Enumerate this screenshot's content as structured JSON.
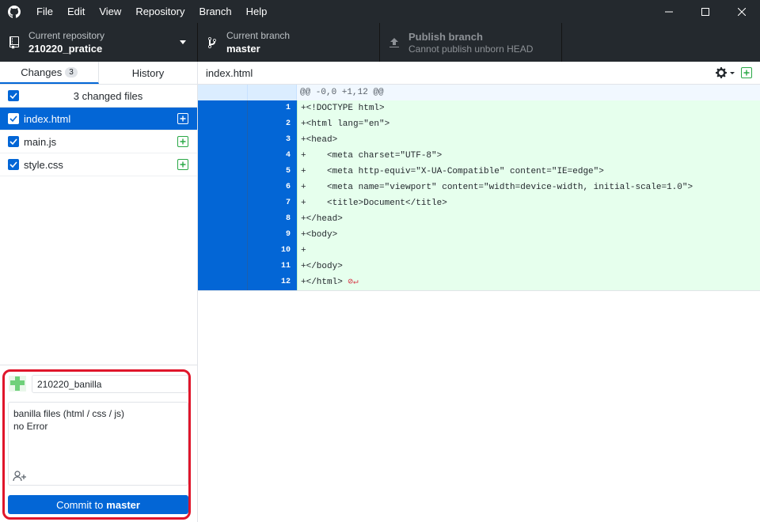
{
  "menubar": {
    "items": [
      "File",
      "Edit",
      "View",
      "Repository",
      "Branch",
      "Help"
    ]
  },
  "toolbar": {
    "repo": {
      "label": "Current repository",
      "value": "210220_pratice"
    },
    "branch": {
      "label": "Current branch",
      "value": "master"
    },
    "publish": {
      "label": "Publish branch",
      "value": "Cannot publish unborn HEAD"
    }
  },
  "sidebar": {
    "tabs": [
      {
        "label": "Changes",
        "count": "3"
      },
      {
        "label": "History"
      }
    ],
    "changes_header": "3 changed files",
    "files": [
      {
        "name": "index.html",
        "selected": true
      },
      {
        "name": "main.js",
        "selected": false
      },
      {
        "name": "style.css",
        "selected": false
      }
    ]
  },
  "commit": {
    "summary": "210220_banilla",
    "description_lines": [
      "banilla files (html / css / js)",
      "no Error"
    ],
    "button_prefix": "Commit to",
    "button_branch": "master"
  },
  "diff": {
    "filename": "index.html",
    "hunk_header": "@@ -0,0 +1,12 @@",
    "line_numbers": [
      "1",
      "2",
      "3",
      "4",
      "5",
      "6",
      "7",
      "8",
      "9",
      "10",
      "11",
      "12"
    ],
    "lines": [
      "+<!DOCTYPE html>",
      "+<html lang=\"en\">",
      "+<head>",
      "+    <meta charset=\"UTF-8\">",
      "+    <meta http-equiv=\"X-UA-Compatible\" content=\"IE=edge\">",
      "+    <meta name=\"viewport\" content=\"width=device-width, initial-scale=1.0\">",
      "+    <title>Document</title>",
      "+</head>",
      "+<body>",
      "+",
      "+</body>",
      "+</html>"
    ]
  },
  "colors": {
    "accent": "#0366d6",
    "added_bg": "#e6ffed",
    "highlight": "#e0162b",
    "chrome": "#24292e"
  }
}
